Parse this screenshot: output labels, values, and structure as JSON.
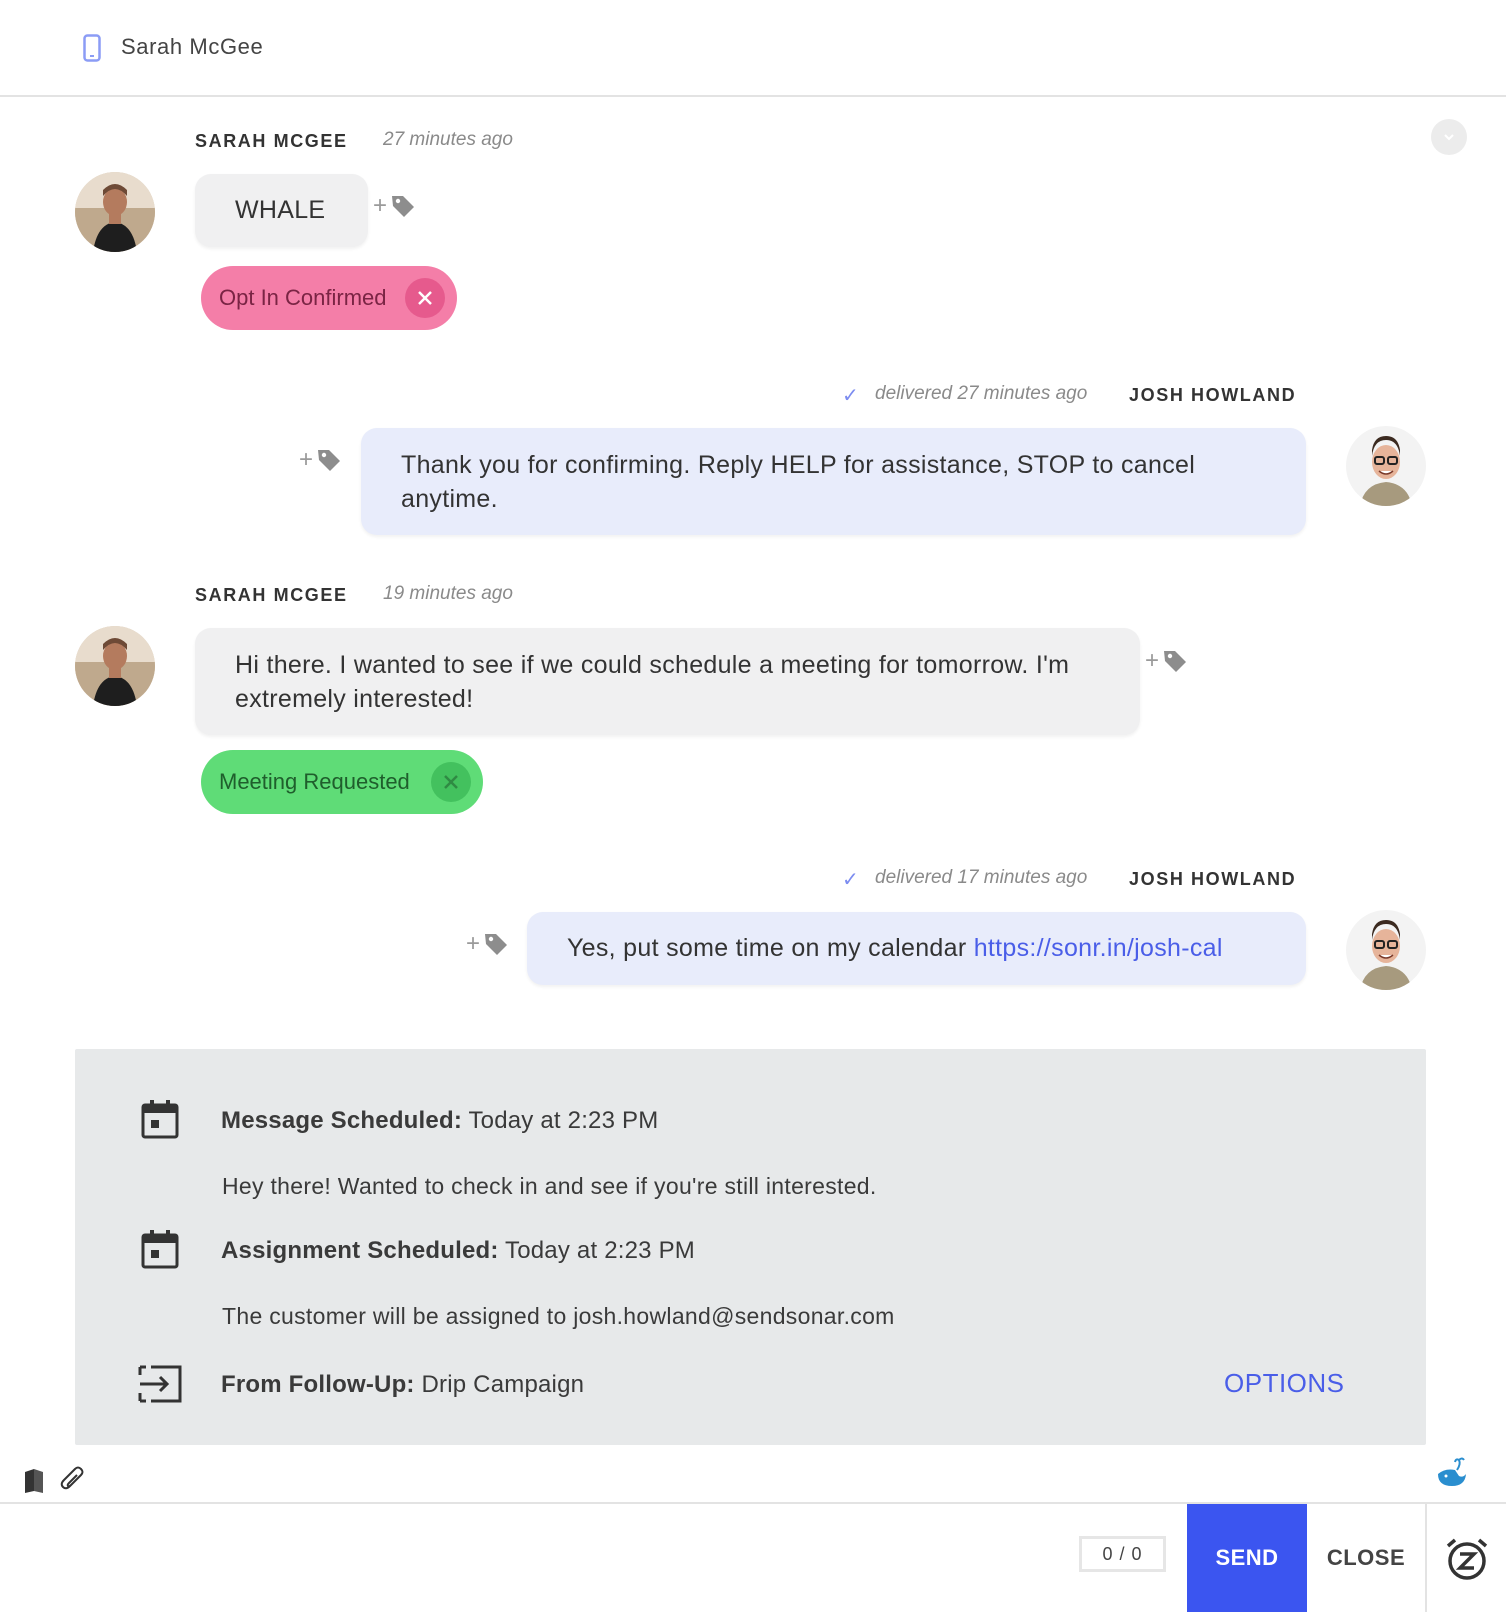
{
  "header": {
    "contact_name": "Sarah McGee",
    "icon": "phone-icon"
  },
  "colors": {
    "accent": "#3b55f0",
    "link": "#4a5ee8",
    "tag_pink": "#f47ea8",
    "tag_green": "#5fdc77",
    "outgoing_bubble": "#e8ecfb",
    "incoming_bubble": "#f0f0f1"
  },
  "messages": [
    {
      "sender": "SARAH MCGEE",
      "time": "27 minutes ago",
      "text": "WHALE",
      "direction": "incoming",
      "tag": "Opt In Confirmed"
    },
    {
      "sender": "JOSH HOWLAND",
      "time": "delivered 27 minutes ago",
      "text": "Thank you for confirming. Reply HELP for assistance, STOP to cancel anytime.",
      "direction": "outgoing"
    },
    {
      "sender": "SARAH MCGEE",
      "time": "19 minutes ago",
      "text": "Hi there. I wanted to see if we could schedule a meeting for tomorrow. I'm extremely interested!",
      "direction": "incoming",
      "tag": "Meeting Requested"
    },
    {
      "sender": "JOSH HOWLAND",
      "time": "delivered 17 minutes ago",
      "text": "Yes, put some time on my calendar ",
      "link": "https://sonr.in/josh-cal",
      "direction": "outgoing"
    }
  ],
  "scheduled": {
    "message_label": "Message Scheduled:",
    "message_time": " Today at 2:23 PM",
    "message_text": "Hey there! Wanted to check in and see if you're still interested.",
    "assignment_label": "Assignment Scheduled:",
    "assignment_time": " Today at 2:23 PM",
    "assignment_text": "The customer will be assigned to josh.howland@sendsonar.com",
    "followup_label": "From Follow-Up:",
    "followup_value": " Drip Campaign",
    "options_label": "OPTIONS"
  },
  "composer": {
    "counter": "0 / 0",
    "send_label": "SEND",
    "close_label": "CLOSE"
  }
}
